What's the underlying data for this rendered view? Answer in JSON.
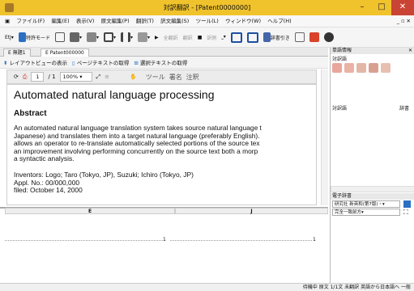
{
  "window": {
    "title": "対訳翻訳 - [Patent0000000]",
    "min": "–",
    "max": "□",
    "close": "✕"
  },
  "menu": {
    "items": [
      "ファイル(F)",
      "編集(E)",
      "表示(V)",
      "原文編集(P)",
      "翻訳(T)",
      "訳文編集(S)",
      "ツール(L)",
      "ウィンドウ(W)",
      "ヘルプ(H)"
    ],
    "right": "_ ▫ ✕"
  },
  "toolbar": {
    "items": [
      "EtJ▾",
      "特許モード",
      "全翻訳",
      "翻訳",
      "訳例",
      "辞書引き"
    ]
  },
  "tabs": {
    "items": [
      "無題1",
      "Patent000000"
    ]
  },
  "subbar": {
    "layout": "レイアウトビューの表示",
    "page_text": "ページテキストの取得",
    "selection_text": "選択テキストの取得"
  },
  "doctool": {
    "page_value": "1",
    "page_total": "/ 1",
    "zoom": "100%",
    "tools": "ツール",
    "sign": "署名",
    "comment": "注釈"
  },
  "document": {
    "title": "Automated natural language processing",
    "abstract_heading": "Abstract",
    "abstract_lines": [
      "An automated natural language translation system takes source natural language t",
      "Japanese) and translates them into a target natural language (preferably English).",
      "allows an operator to re-translate automatically selected portions of the source tex",
      "an improvement involving performing concurrently on the source text both a morp",
      "a syntactic analysis."
    ],
    "inventors": "Inventors:  Logo; Taro (Tokyo, JP), Suzuki; Ichiro (Tokyo, JP)",
    "appl": "Appl. No.:  00/000,000",
    "filed": "filed:   October 14, 2000"
  },
  "pane2": {
    "col_e": "E",
    "col_j": "J",
    "row_num_e": "1",
    "row_num_j": "1"
  },
  "right_panel": {
    "header": "単語情報",
    "tab1": "対訳語",
    "tab2": "訳語",
    "col_a": "対訳語",
    "col_b": "辞書",
    "dict_header": "電子辞書",
    "dict_select": "研究社 新英和(第7版)・▾",
    "match_select": "完全一致前方▾"
  },
  "status": {
    "text": "待機中 原文 1/1文 未翻訳 英語から日本語へ 一般"
  }
}
